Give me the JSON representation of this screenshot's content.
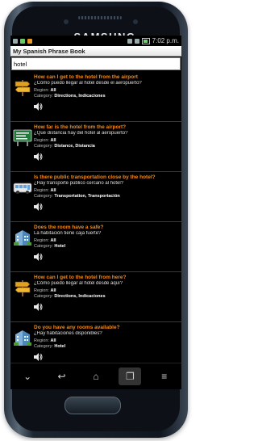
{
  "device": {
    "brand": "SAMSUNG"
  },
  "statusbar": {
    "time": "7:02 p.m."
  },
  "app": {
    "title": "My Spanish Phrase Book"
  },
  "search": {
    "value": "hotel"
  },
  "items": [
    {
      "question": "How can I get to the hotel from the airport",
      "answer": "¿Cómo puedo llegar al hotel desde el aeropuerto?",
      "region_label": "Region:",
      "region": "All",
      "category_label": "Category:",
      "category": "Directions, Indicaciones",
      "icon": "signpost-icon"
    },
    {
      "question": "How far is the hotel from the airport?",
      "answer": "¿Qué distancia hay del hotel al aeropuerto?",
      "region_label": "Region:",
      "region": "All",
      "category_label": "Category:",
      "category": "Distance, Distancia",
      "icon": "road-sign-icon"
    },
    {
      "question": "Is there public transportation close by the hotel?",
      "answer": "¿Hay transporte público cercano al hotel?",
      "region_label": "Region:",
      "region": "All",
      "category_label": "Category:",
      "category": "Transportation, Transportación",
      "icon": "bus-icon"
    },
    {
      "question": "Does the room have a safe?",
      "answer": "La habitación tiene caja fuerte?",
      "region_label": "Region:",
      "region": "All",
      "category_label": "Category:",
      "category": "Hotel",
      "icon": "hotel-building-icon"
    },
    {
      "question": "How can I get to the hotel from here?",
      "answer": "¿Cómo puedo llegar al hotel desde aquí?",
      "region_label": "Region:",
      "region": "All",
      "category_label": "Category:",
      "category": "Directions, Indicaciones",
      "icon": "signpost-icon"
    },
    {
      "question": "Do you have any rooms available?",
      "answer": "¿Hay habitaciones disponibles?",
      "region_label": "Region:",
      "region": "All",
      "category_label": "Category:",
      "category": "Hotel",
      "icon": "hotel-building-icon"
    }
  ],
  "colors": {
    "question": "#f08a1c",
    "background": "#000000"
  }
}
